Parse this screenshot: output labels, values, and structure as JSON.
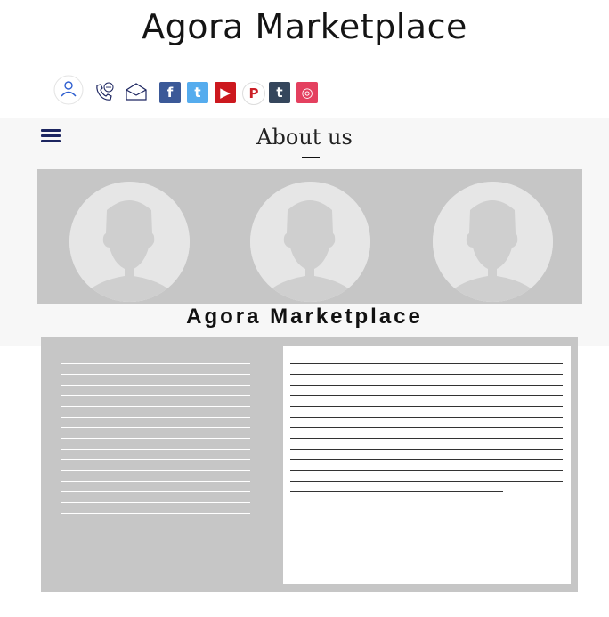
{
  "header": {
    "site_title": "Agora Marketplace"
  },
  "icons": {
    "contact": [
      "user-icon",
      "phone-icon",
      "mail-icon"
    ],
    "social": [
      {
        "name": "facebook-icon",
        "glyph": "f",
        "color": "#3b5998"
      },
      {
        "name": "twitter-icon",
        "glyph": "t",
        "color": "#55acee"
      },
      {
        "name": "youtube-icon",
        "glyph": "▶",
        "color": "#cc181e"
      },
      {
        "name": "pinterest-icon",
        "glyph": "P",
        "color": "#cb2027"
      },
      {
        "name": "tumblr-icon",
        "glyph": "t",
        "color": "#35465c"
      },
      {
        "name": "instagram-icon",
        "glyph": "◎",
        "color": "#e4405f"
      }
    ]
  },
  "about": {
    "heading": "About us",
    "company_name": "Agora Marketplace",
    "team_members": 3
  },
  "content": {
    "left_line_count": 16,
    "right_line_count": 13
  },
  "colors": {
    "panel_gray": "#c6c6c6",
    "band_bg": "#f7f7f7",
    "menu_icon": "#1c2560"
  }
}
